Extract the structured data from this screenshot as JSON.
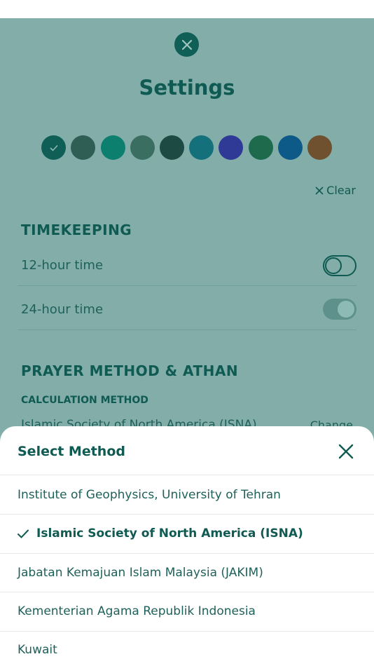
{
  "settings": {
    "title": "Settings",
    "clear_label": "Clear",
    "theme_colors": [
      "#0f5f57",
      "#2f5e54",
      "#0c7f6f",
      "#3a6e60",
      "#1e4a44",
      "#14707a",
      "#2e3a95",
      "#1d6a4d",
      "#0d5a88",
      "#6f5130"
    ],
    "selected_theme_index": 0,
    "timekeeping": {
      "heading": "TIMEKEEPING",
      "option_12h": "12-hour time",
      "option_24h": "24-hour time",
      "toggle_12h_on": false,
      "toggle_24h_on": true
    },
    "prayer": {
      "heading": "PRAYER METHOD & ATHAN",
      "calc_label": "CALCULATION METHOD",
      "calc_value": "Islamic Society of North America (ISNA)",
      "change_label": "Change"
    }
  },
  "sheet": {
    "title": "Select Method",
    "options": [
      "Institute of Geophysics, University of Tehran",
      "Islamic Society of North America (ISNA)",
      "Jabatan Kemajuan Islam Malaysia (JAKIM)",
      "Kementerian Agama Republik Indonesia",
      "Kuwait"
    ],
    "selected_index": 1
  }
}
